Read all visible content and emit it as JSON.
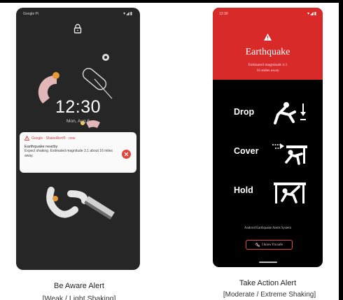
{
  "left_phone": {
    "status_time": "Google Pi",
    "status_icons": "▾◢▮",
    "clock": "12:30",
    "date": "Mon, Aug 8",
    "notification": {
      "app": "Google · ShakeAlert® · now",
      "title": "Earthquake nearby",
      "body": "Expect shaking. Estimated magnitude 3.1 about 16 miles away."
    },
    "caption_title": "Be Aware Alert",
    "caption_subtitle": "[Weak / Light Shaking]"
  },
  "right_phone": {
    "status_time": "12:30",
    "status_icons": "▾◢▮",
    "title": "Earthquake",
    "subtitle_line1": "Estimated magnitude 4.1",
    "subtitle_line2": "16 miles away",
    "actions": [
      "Drop",
      "Cover",
      "Hold"
    ],
    "system_name": "Android Earthquake Alerts System",
    "safe_button": "I know I'm safe",
    "caption_title": "Take Action Alert",
    "caption_subtitle": "[Moderate / Extreme Shaking]"
  },
  "colors": {
    "alert_red": "#d92a2a",
    "lockscreen_bg": "#262626",
    "notification_bg": "#fafafa"
  },
  "icons": [
    "lock-icon",
    "warning-icon",
    "close-icon",
    "drop-pictogram",
    "cover-pictogram",
    "hold-pictogram",
    "phone-icon"
  ]
}
